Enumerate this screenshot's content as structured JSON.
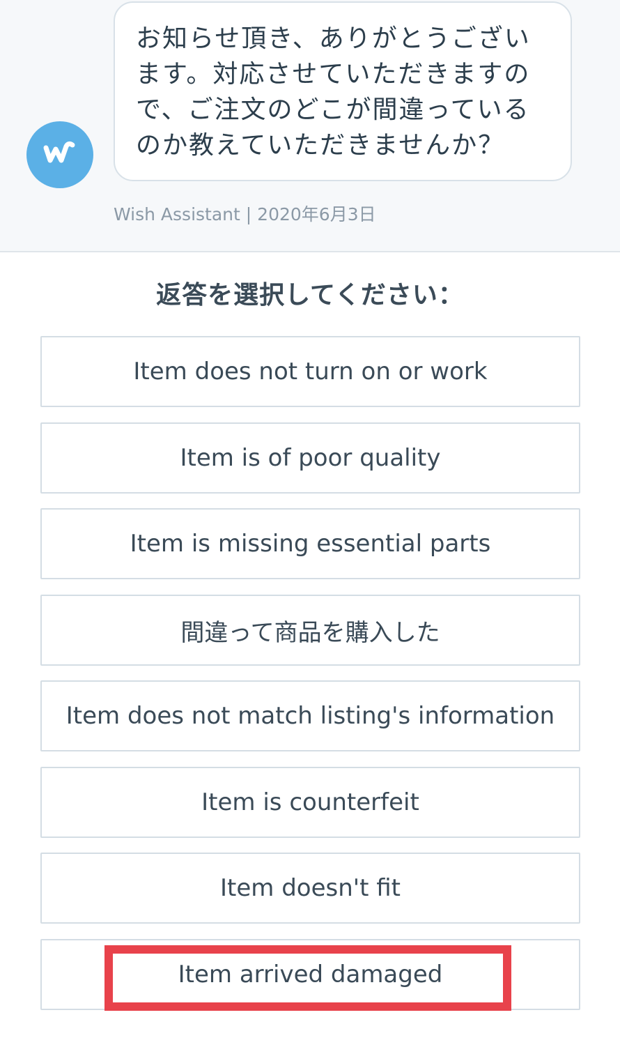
{
  "chat": {
    "message_lines": [
      "お知らせ頂き、ありがとうござい",
      "ます。対応させていただきますの",
      "で、ご注文のどこが間違っている",
      "のか教えていただきませんか？"
    ],
    "sender": "Wish Assistant",
    "separator": "|",
    "date": "2020年6月3日",
    "avatar_icon": "wish-logo-icon",
    "avatar_color": "#5bb0e6"
  },
  "reply": {
    "prompt": "返答を選択してください：",
    "options": [
      "Item does not turn on or work",
      "Item is of poor quality",
      "Item is missing essential parts",
      "間違って商品を購入した",
      "Item does not match listing's information",
      "Item is counterfeit",
      "Item doesn't fit",
      "Item arrived damaged"
    ],
    "highlight_color": "#e8424b"
  }
}
